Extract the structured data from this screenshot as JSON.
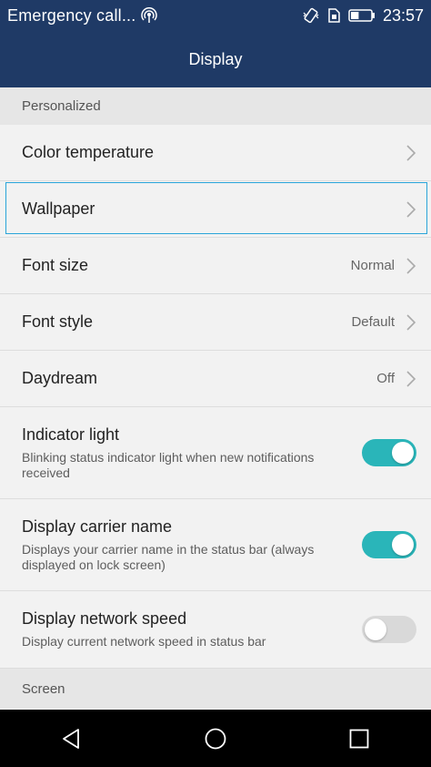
{
  "status_bar": {
    "title": "Emergency call...",
    "time": "23:57",
    "battery_level": 0.4
  },
  "header": {
    "title": "Display"
  },
  "sections": {
    "personalized": "Personalized",
    "screen": "Screen"
  },
  "settings": {
    "color_temperature": {
      "label": "Color temperature"
    },
    "wallpaper": {
      "label": "Wallpaper"
    },
    "font_size": {
      "label": "Font size",
      "value": "Normal"
    },
    "font_style": {
      "label": "Font style",
      "value": "Default"
    },
    "daydream": {
      "label": "Daydream",
      "value": "Off"
    },
    "indicator_light": {
      "label": "Indicator light",
      "description": "Blinking status indicator light when new notifications received",
      "enabled": true
    },
    "carrier_name": {
      "label": "Display carrier name",
      "description": "Displays your carrier name in the status bar (always displayed on lock screen)",
      "enabled": true
    },
    "network_speed": {
      "label": "Display network speed",
      "description": "Display current network speed in status bar",
      "enabled": false
    }
  },
  "colors": {
    "header_bg": "#1f3a66",
    "toggle_on": "#2ab5b9",
    "focus_outline": "#29a4d9"
  },
  "icons": [
    "hotspot-icon",
    "vibrate-icon",
    "sim-icon",
    "battery-icon",
    "chevron-right-icon",
    "back-icon",
    "home-icon",
    "recents-icon"
  ]
}
